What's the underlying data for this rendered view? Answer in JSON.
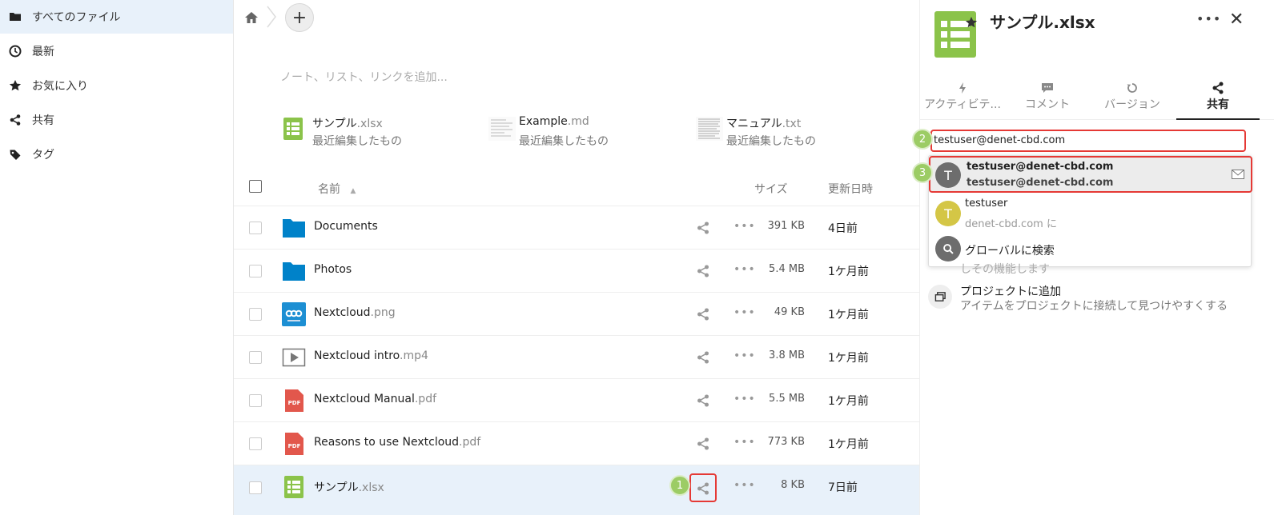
{
  "sidebar": {
    "items": [
      {
        "label": "すべてのファイル",
        "icon": "folder-icon"
      },
      {
        "label": "最新",
        "icon": "clock-icon"
      },
      {
        "label": "お気に入り",
        "icon": "star-icon"
      },
      {
        "label": "共有",
        "icon": "share-icon"
      },
      {
        "label": "タグ",
        "icon": "tag-icon"
      }
    ]
  },
  "main": {
    "rich_workspace_placeholder": "ノート、リスト、リンクを追加...",
    "recent": [
      {
        "base": "サンプル",
        "ext": ".xlsx",
        "sub": "最近編集したもの"
      },
      {
        "base": "Example",
        "ext": ".md",
        "sub": "最近編集したもの"
      },
      {
        "base": "マニュアル",
        "ext": ".txt",
        "sub": "最近編集したもの"
      }
    ],
    "headers": {
      "name": "名前",
      "size": "サイズ",
      "modified": "更新日時"
    },
    "files": [
      {
        "base": "Documents",
        "ext": "",
        "size": "391 KB",
        "modified": "4日前"
      },
      {
        "base": "Photos",
        "ext": "",
        "size": "5.4 MB",
        "modified": "1ケ月前"
      },
      {
        "base": "Nextcloud",
        "ext": ".png",
        "size": "49 KB",
        "modified": "1ケ月前"
      },
      {
        "base": "Nextcloud intro",
        "ext": ".mp4",
        "size": "3.8 MB",
        "modified": "1ケ月前"
      },
      {
        "base": "Nextcloud Manual",
        "ext": ".pdf",
        "size": "5.5 MB",
        "modified": "1ケ月前"
      },
      {
        "base": "Reasons to use Nextcloud",
        "ext": ".pdf",
        "size": "773 KB",
        "modified": "1ケ月前"
      },
      {
        "base": "サンプル",
        "ext": ".xlsx",
        "size": "8 KB",
        "modified": "7日前"
      }
    ]
  },
  "details": {
    "title": "サンプル.xlsx",
    "tabs": [
      {
        "label": "アクティビテ...",
        "icon": "bolt-icon"
      },
      {
        "label": "コメント",
        "icon": "comment-icon"
      },
      {
        "label": "バージョン",
        "icon": "history-icon"
      },
      {
        "label": "共有",
        "icon": "share-icon"
      }
    ],
    "share_input_value": "testuser@denet-cbd.com",
    "suggestions": [
      {
        "avatar": "T",
        "line1": "testuser@denet-cbd.com",
        "line2": "testuser@denet-cbd.com"
      },
      {
        "avatar": "T",
        "line1": "testuser",
        "line2": "denet-cbd.com に"
      },
      {
        "line1": "グローバルに検索"
      }
    ],
    "hidden_text": "しその機能します",
    "project": {
      "title": "プロジェクトに追加",
      "sub": "アイテムをプロジェクトに接続して見つけやすくする"
    }
  },
  "steps": [
    "1",
    "2",
    "3"
  ],
  "colors": {
    "accent_red": "#e53935",
    "badge_green": "#9ccc65",
    "folder_blue": "#0082c9",
    "xlsx_green": "#8bc34a",
    "pdf_red": "#e2574c",
    "avatar_grey": "#6d6d6d",
    "avatar_yellow": "#d4c646"
  }
}
